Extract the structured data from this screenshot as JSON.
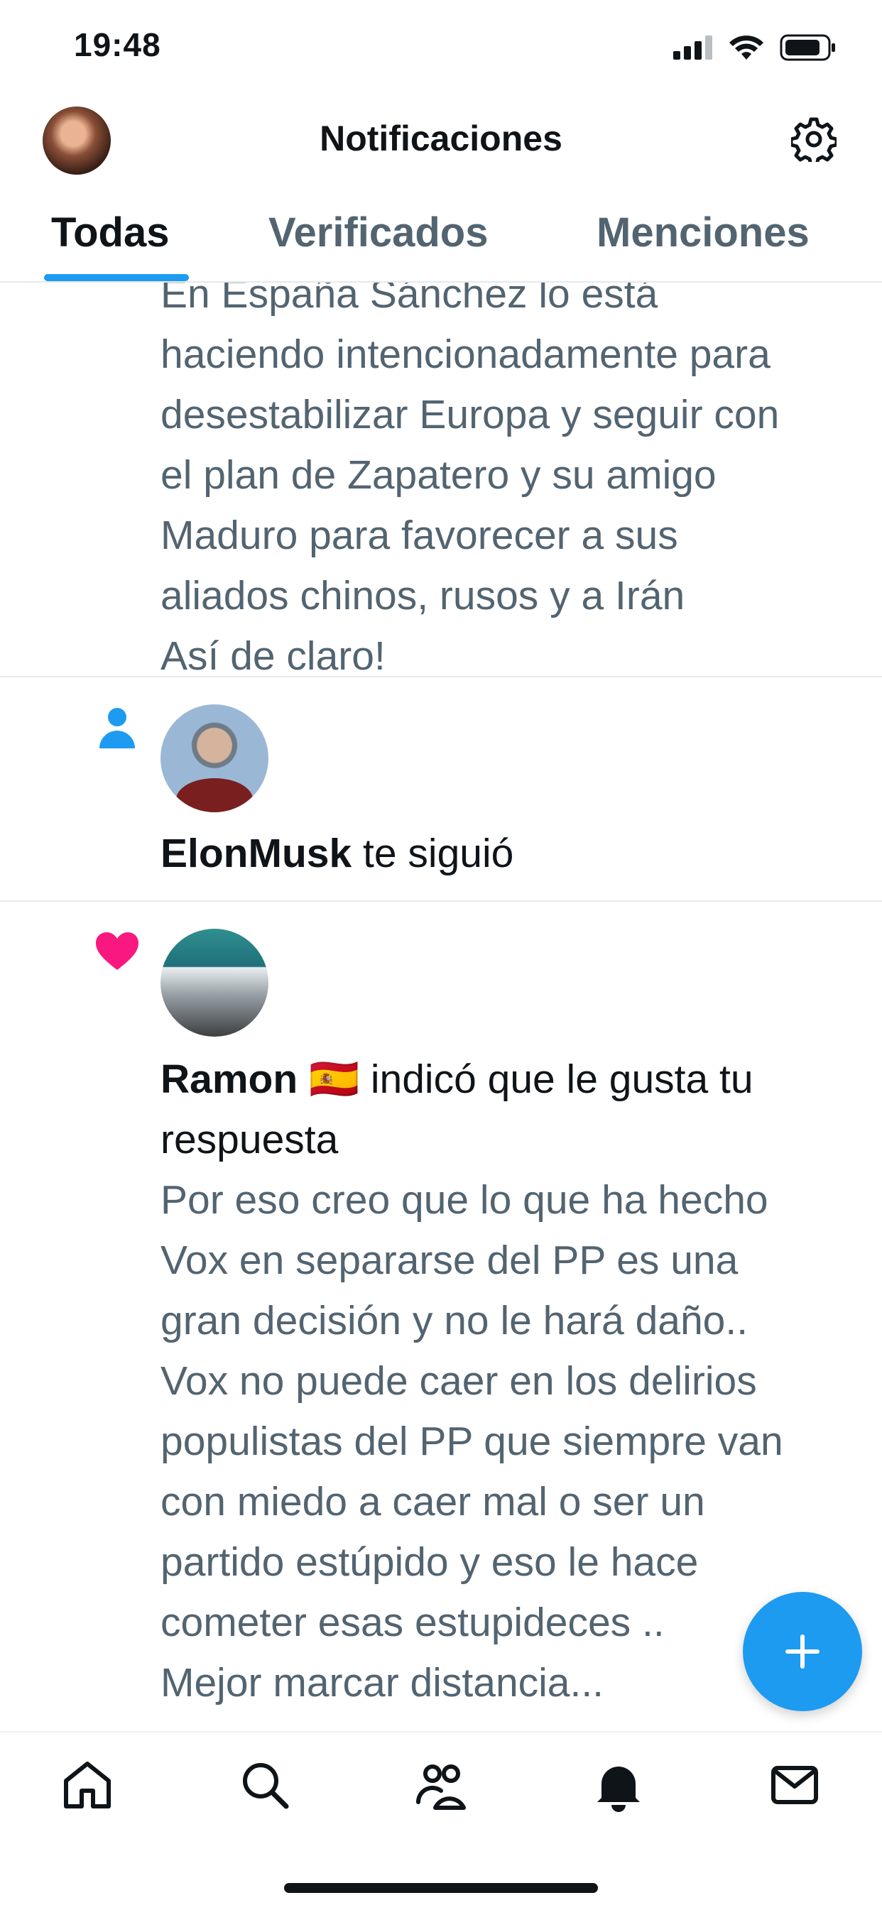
{
  "status_bar": {
    "time": "19:48"
  },
  "header": {
    "title": "Notificaciones"
  },
  "tabs": [
    {
      "label": "Todas",
      "active": true
    },
    {
      "label": "Verificados",
      "active": false
    },
    {
      "label": "Menciones",
      "active": false
    }
  ],
  "notifications": [
    {
      "type": "reply-continuation",
      "text": "En España Sánchez lo está\nhaciendo intencionadamente para\ndesestabilizar Europa y seguir con\nel plan de Zapatero y su amigo\nMaduro para favorecer a sus\naliados chinos, rusos y a Irán\nAsí de claro!"
    },
    {
      "type": "follow",
      "icon": "person-icon",
      "user": "ElonMusk",
      "action": " te siguió"
    },
    {
      "type": "like",
      "icon": "heart-icon",
      "user": "Ramon",
      "flag": "🇪🇸",
      "action": " indicó que le gusta tu\nrespuesta",
      "text": "Por eso creo que lo que ha hecho\nVox en separarse del PP es una\ngran decisión y no le hará daño..\nVox no puede caer en los delirios\npopulistas del PP que siempre van\ncon miedo a caer mal o ser un\npartido estúpido y eso le hace\ncometer esas estupideces ..\nMejor marcar distancia..."
    }
  ],
  "bottom_nav": [
    "home-icon",
    "search-icon",
    "communities-icon",
    "notifications-icon",
    "messages-icon"
  ],
  "colors": {
    "accent": "#1d9bf0",
    "like": "#f91880",
    "text": "#0f1419",
    "secondary": "#536471"
  }
}
